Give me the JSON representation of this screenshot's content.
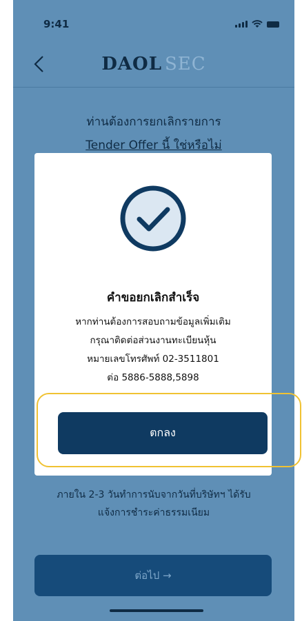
{
  "status_bar": {
    "time": "9:41"
  },
  "nav": {
    "logo_primary": "DAOL",
    "logo_secondary": "SEC"
  },
  "question": {
    "line1": "ท่านต้องการยกเลิกรายการ",
    "line2": "Tender Offer นี้ ใช่หรือไม่"
  },
  "modal": {
    "title": "คำขอยกเลิกสำเร็จ",
    "body_lines": [
      "หากท่านต้องการสอบถามข้อมูลเพิ่มเติม",
      "กรุณาติดต่อส่วนงานทะเบียนหุ้น",
      "หมายเลขโทรศัพท์ 02-3511801",
      "ต่อ 5886-5888,5898"
    ],
    "ok_label": "ตกลง",
    "icon": "check-circle-icon"
  },
  "footer": {
    "note_line1": "ภายใน 2-3 วันทำการนับจากวันที่บริษัทฯ ได้รับ",
    "note_line2": "แจ้งการชำระค่าธรรมเนียม",
    "next_label": "ต่อไป →"
  },
  "colors": {
    "overlay": "#5f8fb6",
    "primary": "#0f3a61",
    "highlight": "#f0c232",
    "check_light": "#dbe7f2"
  }
}
